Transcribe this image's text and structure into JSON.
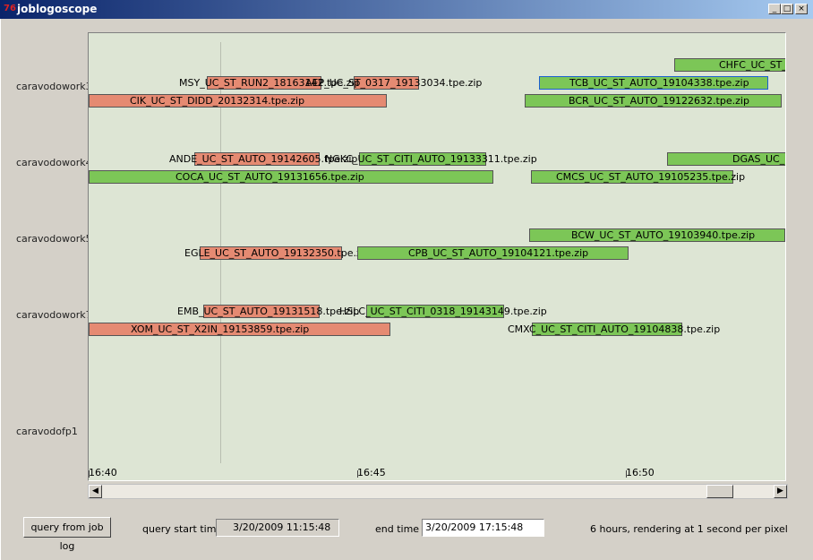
{
  "window": {
    "title": "joblogoscope",
    "icon": "app-icon"
  },
  "colors": {
    "red": "#e58a72",
    "green": "#7cc657",
    "plot_bg": "#dde5d4",
    "selected_border": "#1a5fd0"
  },
  "rows": [
    {
      "label": "caravodowork3"
    },
    {
      "label": "caravodowork4"
    },
    {
      "label": "caravodowork5"
    },
    {
      "label": "caravodowork7"
    },
    {
      "label": "caravodofp1"
    }
  ],
  "bars": [
    {
      "label": "CHFC_UC_ST_"
    },
    {
      "label": "MSY_UC_ST_RUN2_18163142.tpe.zip"
    },
    {
      "label": "AEP_UC_ST_0317_19133034.tpe.zip"
    },
    {
      "label": "TCB_UC_ST_AUTO_19104338.tpe.zip"
    },
    {
      "label": "CIK_UC_ST_DIDD_20132314.tpe.zip"
    },
    {
      "label": "BCR_UC_ST_AUTO_19122632.tpe.zip"
    },
    {
      "label": "ANDE_UC_ST_AUTO_19142605.tpe.zip"
    },
    {
      "label": "NGKC_UC_ST_CITI_AUTO_19133311.tpe.zip"
    },
    {
      "label": "DGAS_UC_"
    },
    {
      "label": "COCA_UC_ST_AUTO_19131656.tpe.zip"
    },
    {
      "label": "CMCS_UC_ST_AUTO_19105235.tpe.zip"
    },
    {
      "label": "BCW_UC_ST_AUTO_19103940.tpe.zip"
    },
    {
      "label": "EGLE_UC_ST_AUTO_19132350.tpe.zip"
    },
    {
      "label": "CPB_UC_ST_AUTO_19104121.tpe.zip"
    },
    {
      "label": "EMB_UC_ST_AUTO_19131518.tpe.zip"
    },
    {
      "label": "HSLC_UC_ST_CITI_0318_19143149.tpe.zip"
    },
    {
      "label": "XOM_UC_ST_X2IN_19153859.tpe.zip"
    },
    {
      "label": "CMXC_UC_ST_CITI_AUTO_19104838.tpe.zip"
    }
  ],
  "axis": {
    "ticks": [
      "16:40",
      "16:45",
      "16:50"
    ]
  },
  "controls": {
    "query_button": "query from job log",
    "start_label": "query start time",
    "start_value": "3/20/2009 11:15:48",
    "end_label": "end time",
    "end_value": "3/20/2009 17:15:48",
    "status": "6 hours, rendering at 1 second per pixel"
  }
}
